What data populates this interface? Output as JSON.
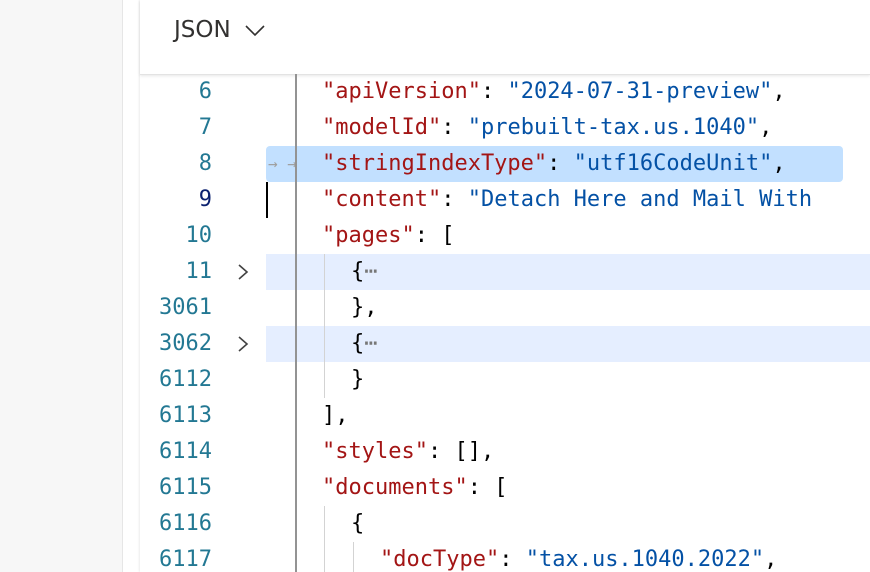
{
  "header": {
    "language": "JSON",
    "dropdown_icon": "chevron-down-icon"
  },
  "editor": {
    "lines": [
      {
        "num": "6",
        "key": "\"apiVersion\"",
        "sep": ": ",
        "val": "\"2024-07-31-preview\"",
        "tail": ","
      },
      {
        "num": "7",
        "key": "\"modelId\"",
        "sep": ": ",
        "val": "\"prebuilt-tax.us.1040\"",
        "tail": ","
      },
      {
        "num": "8",
        "key": "\"stringIndexType\"",
        "sep": ": ",
        "val": "\"utf16CodeUnit\"",
        "tail": ","
      },
      {
        "num": "9",
        "key": "\"content\"",
        "sep": ": ",
        "val": "\"Detach Here and Mail With",
        "tail": ""
      },
      {
        "num": "10",
        "key": "\"pages\"",
        "sep": ": ",
        "val": "",
        "tail": "["
      },
      {
        "num": "11",
        "text": "{",
        "ellipsis": "⋯"
      },
      {
        "num": "3061",
        "text": "},"
      },
      {
        "num": "3062",
        "text": "{",
        "ellipsis": "⋯"
      },
      {
        "num": "6112",
        "text": "}"
      },
      {
        "num": "6113",
        "text": "],"
      },
      {
        "num": "6114",
        "key": "\"styles\"",
        "sep": ": ",
        "val": "",
        "tail": "[],"
      },
      {
        "num": "6115",
        "key": "\"documents\"",
        "sep": ": ",
        "val": "",
        "tail": "["
      },
      {
        "num": "6116",
        "text": "{"
      },
      {
        "num": "6117",
        "key": "\"docType\"",
        "sep": ": ",
        "val": "\"tax.us.1040.2022\"",
        "tail": ","
      }
    ],
    "whitespace_marker": "→ →",
    "colors": {
      "line_number": "#237893",
      "key": "#a31515",
      "string": "#0451a5",
      "selection": "#add6ff"
    }
  }
}
